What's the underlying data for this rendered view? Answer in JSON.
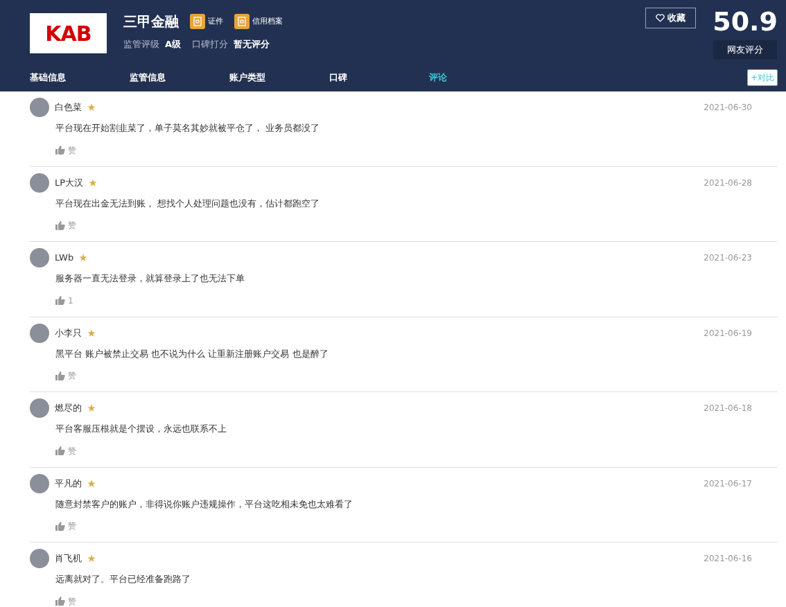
{
  "broker": {
    "logo": "KAB",
    "name": "三甲金融",
    "badges": [
      "证件",
      "信用档案"
    ],
    "ratings": [
      {
        "label": "监管评级",
        "value": "A级"
      },
      {
        "label": "口碑打分",
        "value": "暂无评分"
      }
    ],
    "favorite": "收藏",
    "score": "50.9",
    "score_label": "网友评分"
  },
  "tabs": [
    {
      "label": "基础信息",
      "selected": false
    },
    {
      "label": "监管信息",
      "selected": false
    },
    {
      "label": "账户类型",
      "selected": false
    },
    {
      "label": "口碑",
      "selected": false
    },
    {
      "label": "评论",
      "selected": true
    }
  ],
  "compare": "+对比",
  "comments": [
    {
      "user": "白色菜",
      "date": "2021-06-30",
      "text": "平台现在开始割韭菜了，单子莫名其妙就被平仓了， 业务员都没了",
      "likes": "赞"
    },
    {
      "user": "LP大汉",
      "date": "2021-06-28",
      "text": "平台现在出金无法到账， 想找个人处理问题也没有，估计都跑空了",
      "likes": "赞"
    },
    {
      "user": "LWb",
      "date": "2021-06-23",
      "text": "服务器一直无法登录，就算登录上了也无法下单",
      "likes": "1"
    },
    {
      "user": "小李只",
      "date": "2021-06-19",
      "text": "黑平台 账户被禁止交易 也不说为什么 让重新注册账户交易 也是醉了",
      "likes": "赞"
    },
    {
      "user": "燃尽的",
      "date": "2021-06-18",
      "text": "平台客服压根就是个摆设，永远也联系不上",
      "likes": "赞"
    },
    {
      "user": "平凡的",
      "date": "2021-06-17",
      "text": "随意封禁客户的账户，非得说你账户违规操作，平台这吃相未免也太难看了",
      "likes": "赞"
    },
    {
      "user": "肖飞机",
      "date": "2021-06-16",
      "text": "远离就对了。平台已经准备跑路了",
      "likes": "赞"
    }
  ]
}
